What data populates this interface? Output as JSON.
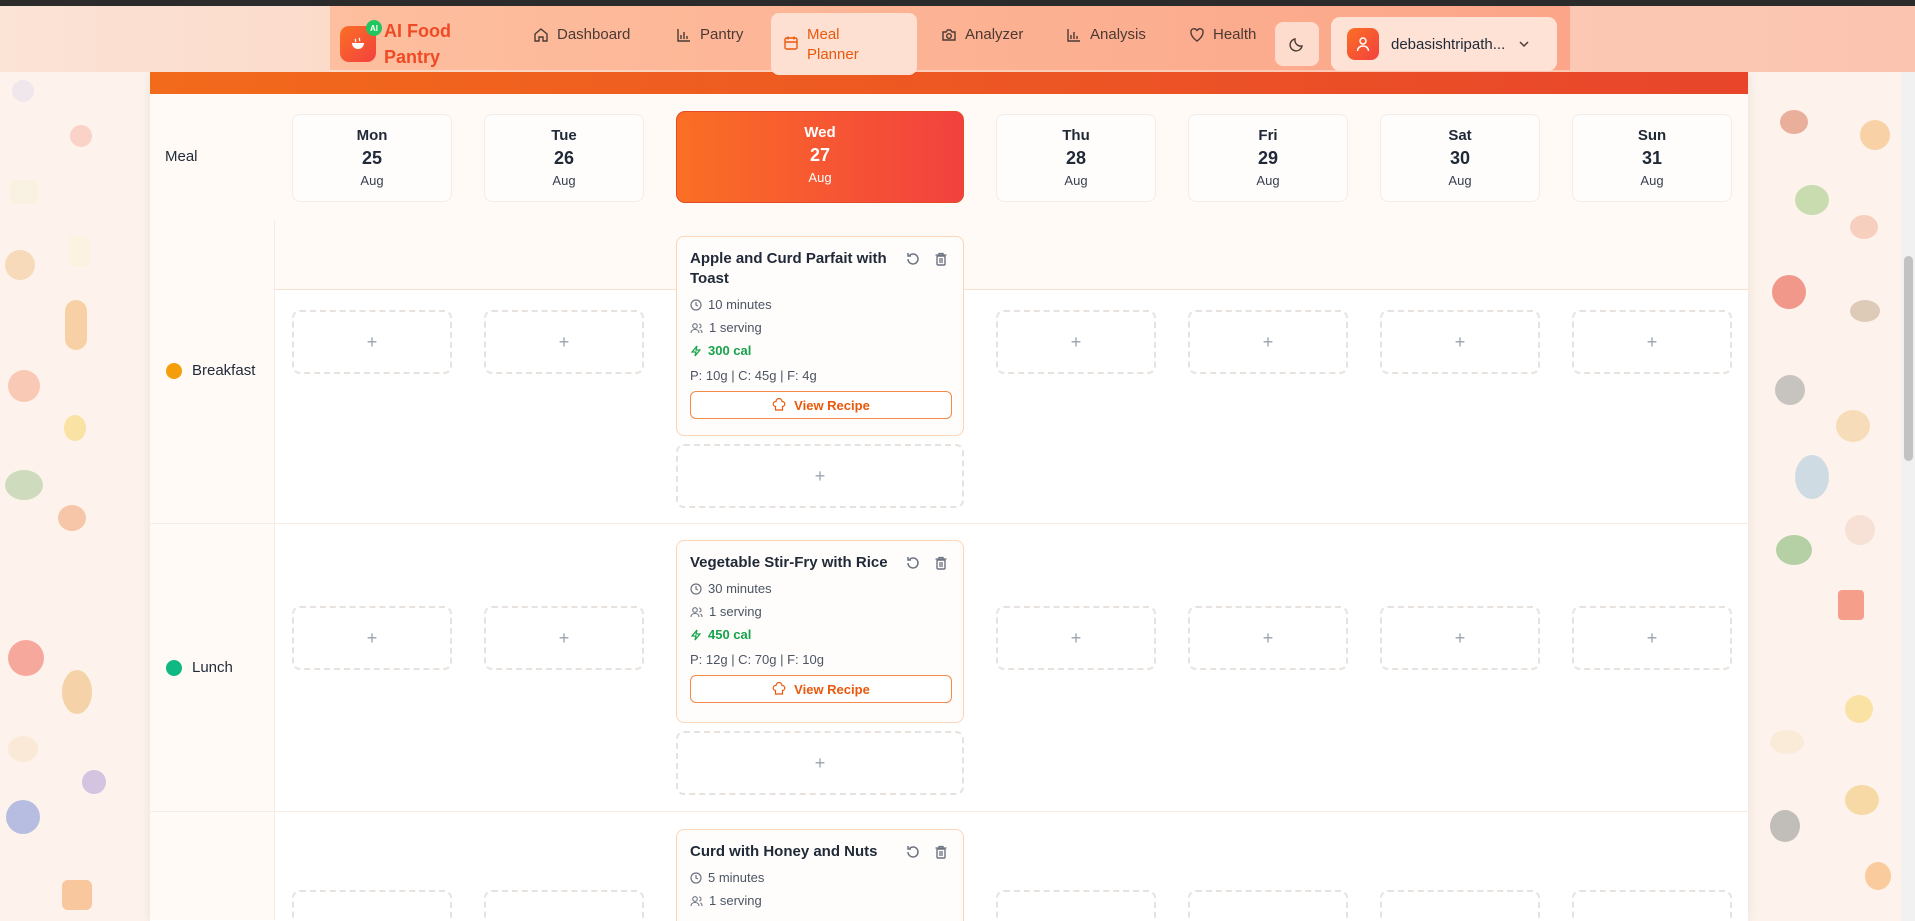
{
  "brand": {
    "name": "AI Food Pantry",
    "badge": "AI"
  },
  "nav": {
    "items": [
      {
        "label": "Dashboard",
        "icon": "home-icon"
      },
      {
        "label": "Pantry",
        "icon": "bar-chart-icon"
      },
      {
        "label": "Meal Planner",
        "icon": "calendar-icon"
      },
      {
        "label": "Analyzer",
        "icon": "camera-icon"
      },
      {
        "label": "Analysis",
        "icon": "bar-chart-icon"
      },
      {
        "label": "Health",
        "icon": "heart-icon"
      }
    ],
    "active": "Meal Planner",
    "theme_icon": "moon-icon",
    "user": "debasishtripath..."
  },
  "planner": {
    "meal_header": "Meal",
    "days": [
      {
        "name": "Mon",
        "num": "25",
        "month": "Aug"
      },
      {
        "name": "Tue",
        "num": "26",
        "month": "Aug"
      },
      {
        "name": "Wed",
        "num": "27",
        "month": "Aug"
      },
      {
        "name": "Thu",
        "num": "28",
        "month": "Aug"
      },
      {
        "name": "Fri",
        "num": "29",
        "month": "Aug"
      },
      {
        "name": "Sat",
        "num": "30",
        "month": "Aug"
      },
      {
        "name": "Sun",
        "num": "31",
        "month": "Aug"
      }
    ],
    "add_symbol": "+",
    "meals": [
      {
        "label": "Breakfast",
        "color": "#f59e0b",
        "card": {
          "title": "Apple and Curd Parfait with Toast",
          "time": "10 minutes",
          "servings": "1 serving",
          "calories": "300 cal",
          "macros": "P: 10g | C: 45g | F: 4g",
          "button": "View Recipe"
        }
      },
      {
        "label": "Lunch",
        "color": "#10b981",
        "card": {
          "title": "Vegetable Stir-Fry with Rice",
          "time": "30 minutes",
          "servings": "1 serving",
          "calories": "450 cal",
          "macros": "P: 12g | C: 70g | F: 10g",
          "button": "View Recipe"
        }
      },
      {
        "label": "",
        "card": {
          "title": "Curd with Honey and Nuts",
          "time": "5 minutes",
          "servings": "1 serving"
        }
      }
    ]
  }
}
